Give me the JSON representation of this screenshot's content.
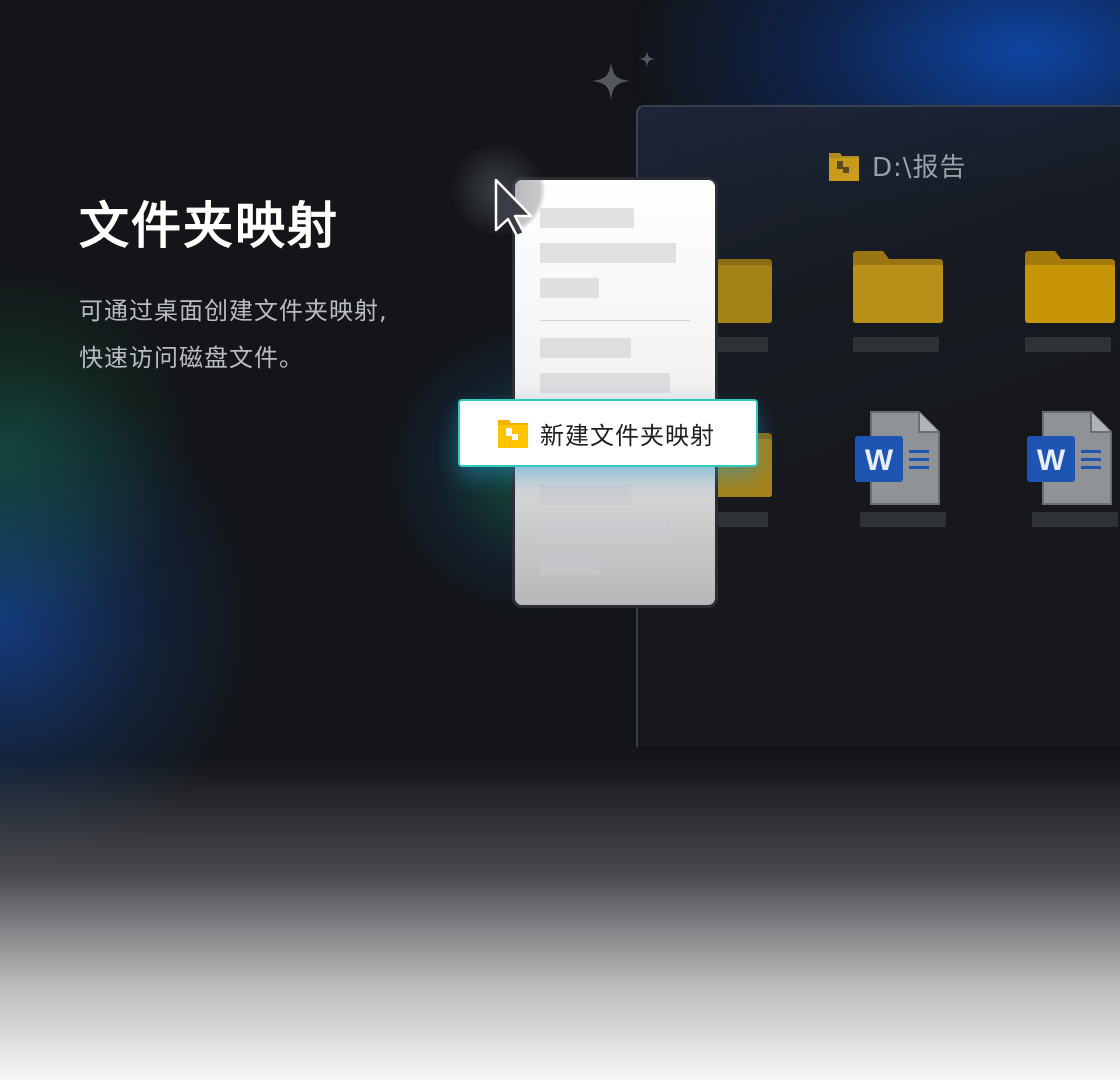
{
  "hero": {
    "title": "文件夹映射",
    "description_line1": "可通过桌面创建文件夹映射,",
    "description_line2": "快速访问磁盘文件。"
  },
  "window": {
    "path": "D:\\报告",
    "path_icon": "mapped-folder-icon",
    "items": [
      {
        "icon": "folder-icon"
      },
      {
        "icon": "folder-icon"
      },
      {
        "icon": "folder-icon"
      },
      {
        "icon": "folder-icon"
      },
      {
        "icon": "word-document-icon"
      },
      {
        "icon": "word-document-icon"
      }
    ]
  },
  "context_menu": {
    "highlighted_item": {
      "label": "新建文件夹映射",
      "icon": "mapped-folder-icon"
    }
  },
  "colors": {
    "background": "#131518",
    "accent_border": "#2ec9c0",
    "folder_yellow": "#e3a600",
    "word_blue": "#1e55b3"
  }
}
